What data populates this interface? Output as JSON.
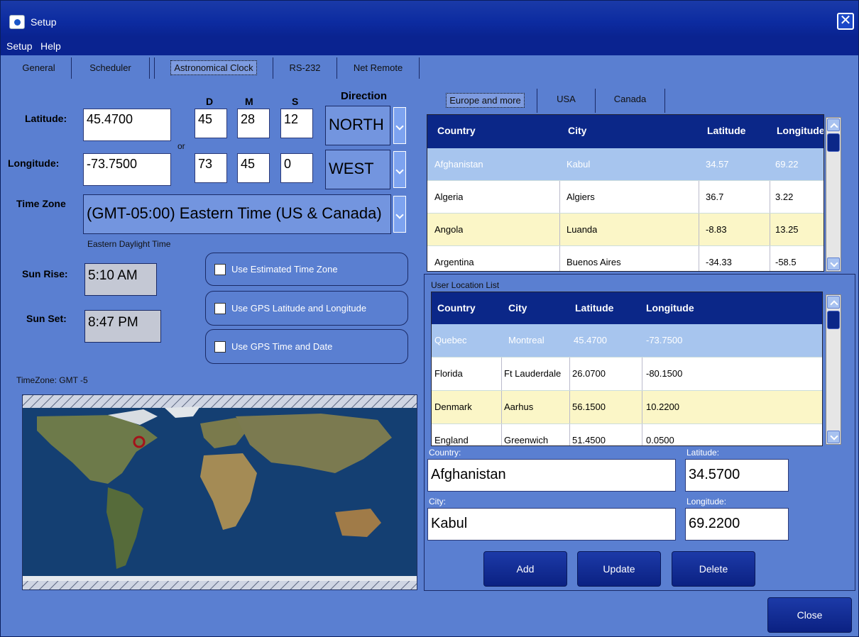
{
  "window": {
    "title": "Setup"
  },
  "menu": [
    "Setup",
    "Help"
  ],
  "tabs": [
    "General",
    "Scheduler",
    "Astronomical Clock",
    "RS-232",
    "Net Remote"
  ],
  "coords": {
    "header_d": "D",
    "header_m": "M",
    "header_s": "S",
    "header_direction": "Direction",
    "or_label": "or",
    "latitude_label": "Latitude:",
    "latitude_value": "45.4700",
    "lat_d": "45",
    "lat_m": "28",
    "lat_s": "12",
    "lat_dir": "NORTH",
    "longitude_label": "Longitude:",
    "longitude_value": "-73.7500",
    "lon_d": "73",
    "lon_m": "45",
    "lon_s": "0",
    "lon_dir": "WEST"
  },
  "timezone": {
    "label": "Time Zone",
    "value": "(GMT-05:00) Eastern Time (US & Canada)",
    "note": "Eastern Daylight Time",
    "map_label": "TimeZone: GMT -5"
  },
  "sun": {
    "rise_label": "Sun Rise:",
    "rise_value": "5:10 AM",
    "set_label": "Sun Set:",
    "set_value": "8:47 PM"
  },
  "options": [
    "Use Estimated Time Zone",
    "Use GPS Latitude and Longitude",
    "Use GPS Time and Date"
  ],
  "region_tabs": [
    "Europe and more",
    "USA",
    "Canada"
  ],
  "city_table": {
    "headers": [
      "Country",
      "City",
      "Latitude",
      "Longitude"
    ],
    "rows": [
      [
        "Afghanistan",
        "Kabul",
        "34.57",
        "69.22"
      ],
      [
        "Algeria",
        "Algiers",
        "36.7",
        "3.22"
      ],
      [
        "Angola",
        "Luanda",
        "-8.83",
        "13.25"
      ],
      [
        "Argentina",
        "Buenos Aires",
        "-34.33",
        "-58.5"
      ]
    ]
  },
  "user_list": {
    "title": "User Location List",
    "headers": [
      "Country",
      "City",
      "Latitude",
      "Longitude"
    ],
    "rows": [
      [
        "Quebec",
        "Montreal",
        "45.4700",
        "-73.7500"
      ],
      [
        "Florida",
        "Ft Lauderdale",
        "26.0700",
        "-80.1500"
      ],
      [
        "Denmark",
        "Aarhus",
        "56.1500",
        "10.2200"
      ],
      [
        "England",
        "Greenwich",
        "51.4500",
        "0.0500"
      ]
    ]
  },
  "form": {
    "country_label": "Country:",
    "country_value": "Afghanistan",
    "latitude_label": "Latitude:",
    "latitude_value": "34.5700",
    "city_label": "City:",
    "city_value": "Kabul",
    "longitude_label": "Longitude:",
    "longitude_value": "69.2200"
  },
  "buttons": {
    "add": "Add",
    "update": "Update",
    "delete": "Delete",
    "close": "Close"
  },
  "colors": {
    "title_bar": "#0a2390",
    "window_bg": "#5a7fd1",
    "grid_header": "#0b2788",
    "selected_row": "#a7c5ee",
    "alt_row": "#fbf6c7"
  }
}
